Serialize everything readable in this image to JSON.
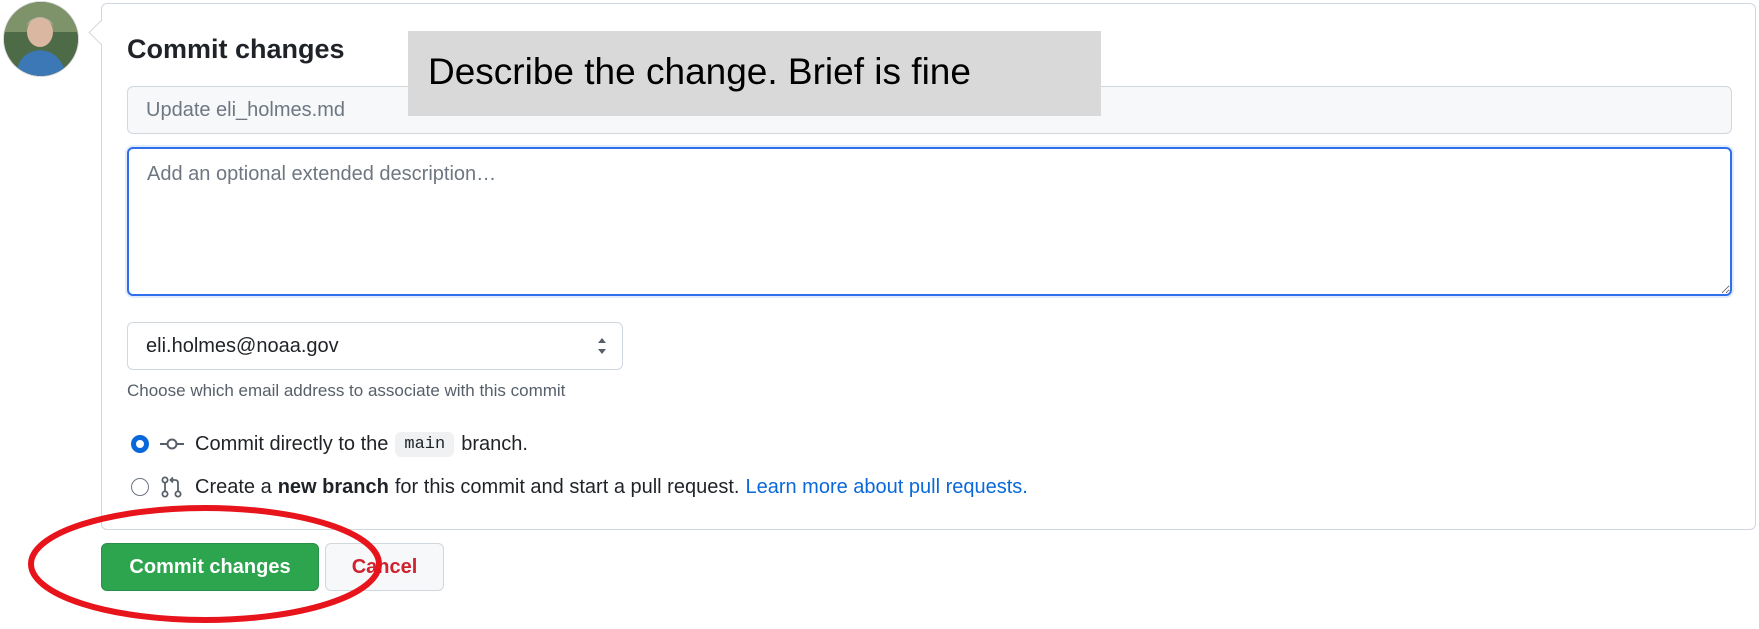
{
  "avatar": {
    "icon": "user-avatar"
  },
  "commit_box": {
    "title": "Commit changes",
    "summary_placeholder": "Update eli_holmes.md",
    "description_placeholder": "Add an optional extended description…",
    "email_select": {
      "selected": "eli.holmes@noaa.gov",
      "help": "Choose which email address to associate with this commit"
    },
    "options": {
      "direct": {
        "pre": "Commit directly to the",
        "branch": "main",
        "post": "branch.",
        "checked": true
      },
      "new_branch": {
        "pre": "Create a",
        "bold": "new branch",
        "post": "for this commit and start a pull request.",
        "link": "Learn more about pull requests.",
        "checked": false
      }
    }
  },
  "buttons": {
    "commit": "Commit changes",
    "cancel": "Cancel"
  },
  "annotation": {
    "callout": "Describe the change. Brief is fine",
    "highlight_color": "#e8141b"
  },
  "colors": {
    "accent": "#0969da",
    "commit_green": "#2da44e",
    "cancel_red": "#cf222e"
  }
}
